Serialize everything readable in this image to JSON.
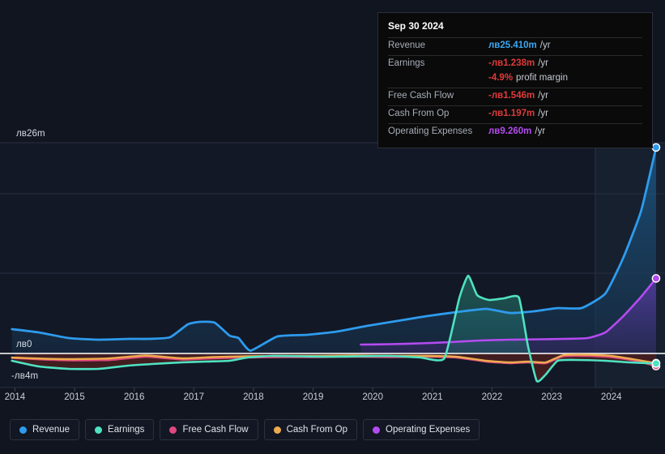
{
  "axis": {
    "y_top_label": "лв26m",
    "y_zero_label": "лв0",
    "y_bottom_label": "-лв4m",
    "x_labels": [
      "2014",
      "2015",
      "2016",
      "2017",
      "2018",
      "2019",
      "2020",
      "2021",
      "2022",
      "2023",
      "2024"
    ]
  },
  "tooltip": {
    "title": "Sep 30 2024",
    "rows": [
      {
        "key": "Revenue",
        "value": "лв25.410m",
        "unit": "/yr",
        "color": "#3aa7f0"
      },
      {
        "key": "Earnings",
        "value": "-лв1.238m",
        "unit": "/yr",
        "color": "#e03a3a"
      },
      {
        "key": "",
        "value": "-4.9%",
        "unit": "profit margin",
        "color": "#e03a3a"
      },
      {
        "key": "Free Cash Flow",
        "value": "-лв1.546m",
        "unit": "/yr",
        "color": "#e03a3a"
      },
      {
        "key": "Cash From Op",
        "value": "-лв1.197m",
        "unit": "/yr",
        "color": "#e03a3a"
      },
      {
        "key": "Operating Expenses",
        "value": "лв9.260m",
        "unit": "/yr",
        "color": "#b44bf0"
      }
    ]
  },
  "legend": [
    {
      "label": "Revenue",
      "color": "#2e9bed"
    },
    {
      "label": "Earnings",
      "color": "#4fe3c1"
    },
    {
      "label": "Free Cash Flow",
      "color": "#e0487f"
    },
    {
      "label": "Cash From Op",
      "color": "#eeab4e"
    },
    {
      "label": "Operating Expenses",
      "color": "#b44bf0"
    }
  ],
  "chart_data": {
    "type": "area",
    "title": "",
    "xlabel": "",
    "ylabel": "",
    "currency": "лв",
    "units": "millions per year",
    "xlim": [
      2013.75,
      2024.9
    ],
    "ylim": [
      -4,
      26
    ],
    "grid": true,
    "zero_line": 0,
    "forecast_start": 2023.85,
    "legend_position": "bottom",
    "series": [
      {
        "name": "Revenue",
        "color": "#2e9bed",
        "fill": "#153049",
        "x": [
          2013.95,
          2014.4,
          2014.9,
          2015.4,
          2015.9,
          2016.25,
          2016.6,
          2016.9,
          2017.1,
          2017.35,
          2017.6,
          2017.75,
          2017.95,
          2018.4,
          2018.9,
          2019.4,
          2019.9,
          2020.4,
          2020.9,
          2021.4,
          2021.9,
          2022.3,
          2022.7,
          2023.1,
          2023.5,
          2023.9,
          2024.2,
          2024.5,
          2024.75
        ],
        "y": [
          3.0,
          2.6,
          1.9,
          1.7,
          1.8,
          1.8,
          2.0,
          3.6,
          3.9,
          3.8,
          2.2,
          1.9,
          0.35,
          2.1,
          2.3,
          2.7,
          3.4,
          4.0,
          4.6,
          5.1,
          5.5,
          5.0,
          5.2,
          5.6,
          5.6,
          7.4,
          11.8,
          17.6,
          25.41
        ]
      },
      {
        "name": "Earnings",
        "color": "#4fe3c1",
        "x": [
          2013.95,
          2014.4,
          2014.9,
          2015.4,
          2015.9,
          2016.3,
          2016.8,
          2017.2,
          2017.6,
          2017.9,
          2018.3,
          2018.8,
          2019.3,
          2019.8,
          2020.3,
          2020.8,
          2021.2,
          2021.45,
          2021.6,
          2021.75,
          2021.95,
          2022.2,
          2022.45,
          2022.6,
          2022.75,
          2022.9,
          2023.1,
          2023.4,
          2023.9,
          2024.3,
          2024.75
        ],
        "y": [
          -0.9,
          -1.6,
          -1.9,
          -1.9,
          -1.5,
          -1.3,
          -1.1,
          -1.0,
          -0.9,
          -0.5,
          -0.3,
          -0.35,
          -0.4,
          -0.35,
          -0.3,
          -0.5,
          -0.6,
          6.8,
          9.6,
          7.2,
          6.6,
          6.8,
          6.9,
          1.0,
          -3.4,
          -2.6,
          -0.9,
          -0.8,
          -0.9,
          -1.1,
          -1.238
        ]
      },
      {
        "name": "Free Cash Flow",
        "color": "#e0487f",
        "x": [
          2013.95,
          2014.5,
          2015.0,
          2015.6,
          2016.2,
          2016.8,
          2017.3,
          2017.9,
          2018.5,
          2019.1,
          2019.7,
          2020.3,
          2020.9,
          2021.4,
          2021.9,
          2022.3,
          2022.6,
          2022.9,
          2023.2,
          2023.6,
          2024.0,
          2024.4,
          2024.75
        ],
        "y": [
          -0.55,
          -0.75,
          -0.85,
          -0.8,
          -0.4,
          -0.75,
          -0.6,
          -0.5,
          -0.45,
          -0.45,
          -0.4,
          -0.45,
          -0.4,
          -0.5,
          -1.0,
          -1.2,
          -1.1,
          -1.2,
          -0.35,
          -0.3,
          -0.45,
          -0.9,
          -1.546
        ]
      },
      {
        "name": "Cash From Op",
        "color": "#eeab4e",
        "x": [
          2013.95,
          2014.5,
          2015.0,
          2015.6,
          2016.2,
          2016.8,
          2017.3,
          2017.9,
          2018.5,
          2019.1,
          2019.7,
          2020.3,
          2020.9,
          2021.4,
          2021.9,
          2022.3,
          2022.6,
          2022.9,
          2023.2,
          2023.6,
          2024.0,
          2024.4,
          2024.75
        ],
        "y": [
          -0.5,
          -0.65,
          -0.7,
          -0.6,
          -0.25,
          -0.6,
          -0.45,
          -0.35,
          -0.3,
          -0.3,
          -0.25,
          -0.3,
          -0.3,
          -0.4,
          -0.9,
          -1.1,
          -1.0,
          -1.1,
          -0.2,
          -0.15,
          -0.3,
          -0.75,
          -1.197
        ]
      },
      {
        "name": "Operating Expenses",
        "color": "#b44bf0",
        "fill": "#2e2558",
        "x": [
          2019.8,
          2020.3,
          2020.8,
          2021.3,
          2021.8,
          2022.3,
          2022.8,
          2023.2,
          2023.6,
          2023.9,
          2024.2,
          2024.5,
          2024.75
        ],
        "y": [
          1.1,
          1.15,
          1.25,
          1.4,
          1.6,
          1.7,
          1.75,
          1.8,
          1.9,
          2.6,
          4.6,
          7.0,
          9.26
        ]
      }
    ]
  }
}
